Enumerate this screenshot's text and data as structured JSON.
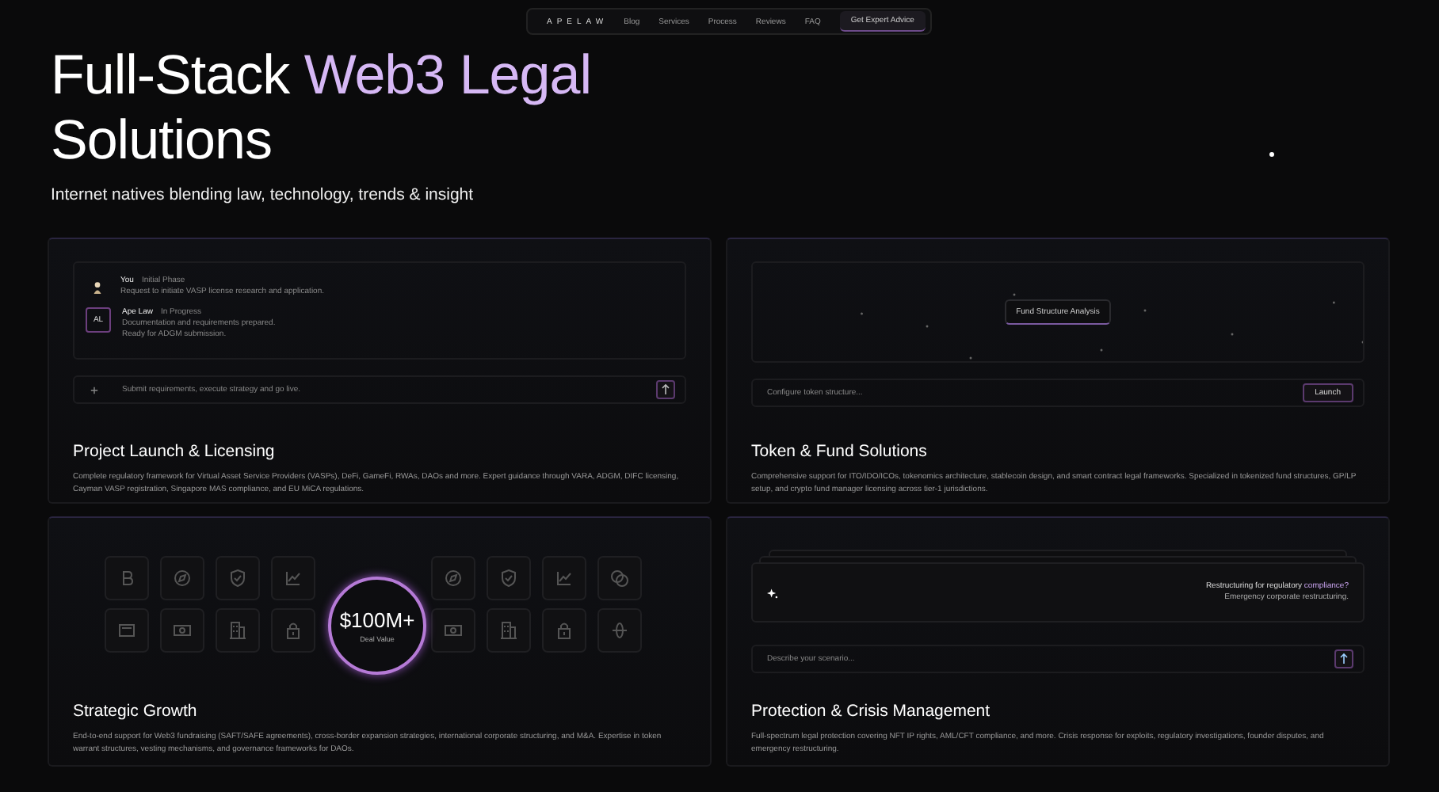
{
  "nav": {
    "logo": "APELAW",
    "links": [
      {
        "label": "Blog"
      },
      {
        "label": "Services"
      },
      {
        "label": "Process"
      },
      {
        "label": "Reviews"
      },
      {
        "label": "FAQ"
      }
    ],
    "cta": "Get Expert Advice"
  },
  "hero": {
    "title_start": "Full-Stack",
    "title_highlight": "Web3 Legal",
    "title_end": "Solutions",
    "subtitle": "Internet natives blending law, technology, trends & insight"
  },
  "cards": [
    {
      "kind": "chat",
      "title": "Project Launch & Licensing",
      "description": "Complete regulatory framework for Virtual Asset Service Providers (VASPs), DeFi, GameFi, RWAs, DAOs and more. Expert guidance through VARA, ADGM, DIFC licensing, Cayman VASP registration, Singapore MAS compliance, and EU MiCA regulations.",
      "messages": [
        {
          "sender": "You",
          "status": "Initial Phase",
          "lines": [
            "Request to initiate VASP license research and application."
          ]
        },
        {
          "sender": "Ape Law",
          "avatar": "AL",
          "status": "In Progress",
          "lines": [
            "Documentation and requirements prepared.",
            "Ready for ADGM submission."
          ]
        }
      ],
      "input_placeholder": "Submit requirements, execute strategy and go live."
    },
    {
      "kind": "token",
      "title": "Token & Fund Solutions",
      "description": "Comprehensive support for ITO/IDO/ICOs, tokenomics architecture, stablecoin design, and smart contract legal frameworks. Specialized in tokenized fund structures, GP/LP setup, and crypto fund manager licensing across tier-1 jurisdictions.",
      "badge": "Fund Structure Analysis",
      "input_placeholder": "Configure token structure...",
      "button": "Launch"
    },
    {
      "kind": "growth",
      "title": "Strategic Growth",
      "description": "End-to-end support for Web3 fundraising (SAFT/SAFE agreements), cross-border expansion strategies, international corporate structuring, and M&A. Expertise in token warrant structures, vesting mechanisms, and governance frameworks for DAOs.",
      "stat": "$100M+",
      "stat_label": "Deal Value"
    },
    {
      "kind": "protection",
      "title": "Protection & Crisis Management",
      "description": "Full-spectrum legal protection covering NFT IP rights, AML/CFT compliance, and more. Crisis response for exploits, regulatory investigations, founder disputes, and emergency restructuring.",
      "question": "Restructuring for regulatory",
      "highlight": "compliance?",
      "answer": "Emergency corporate restructuring.",
      "input_placeholder": "Describe your scenario..."
    }
  ]
}
